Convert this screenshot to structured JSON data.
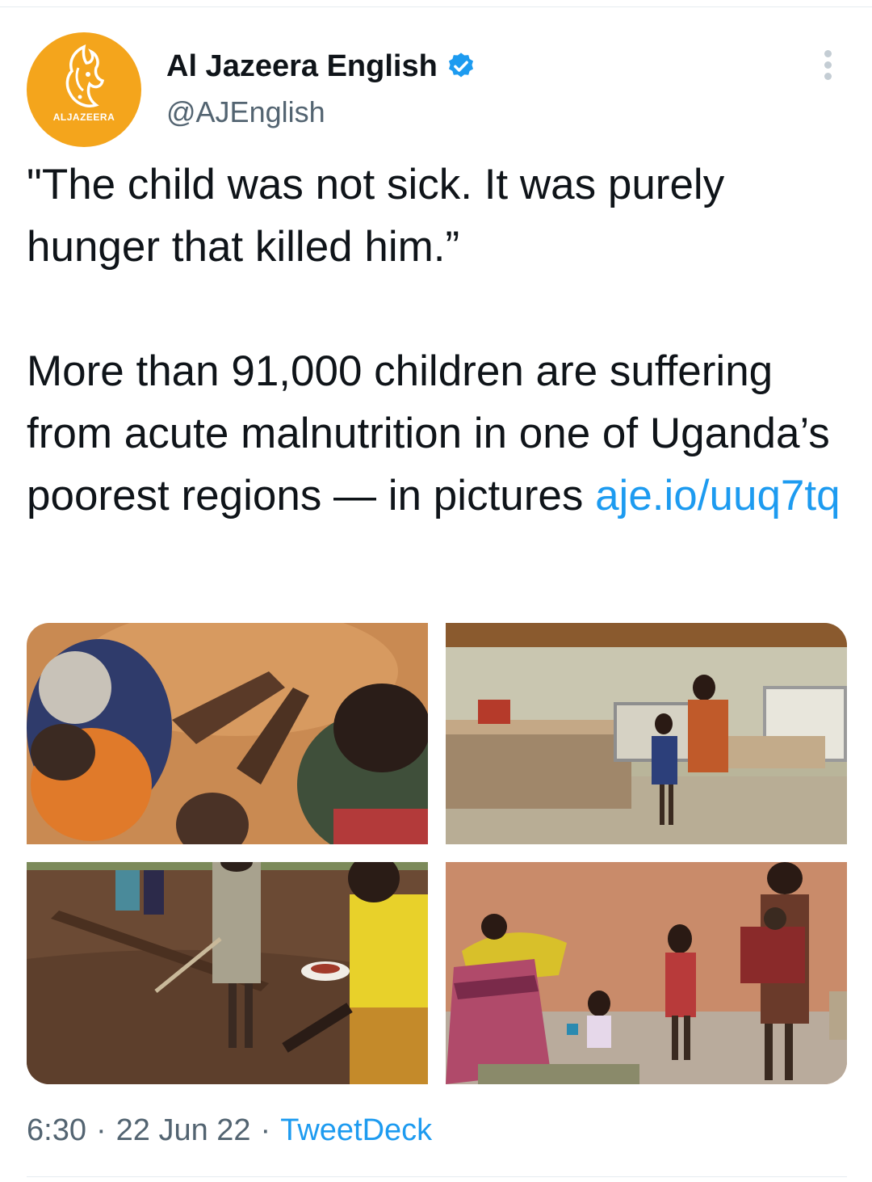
{
  "author": {
    "display_name": "Al Jazeera English",
    "handle": "@AJEnglish",
    "avatar_logo_text": "ALJAZEERA",
    "verified": true,
    "avatar_color": "#f4a51c",
    "verified_color": "#1d9bf0"
  },
  "tweet": {
    "line1": "\"The child was not sick. It was purely hunger that killed him.”",
    "line2_text": "More than 91,000 children are suffering from acute malnutrition in one of Uganda’s poorest regions — in pictures ",
    "link_text": "aje.io/uuq7tq"
  },
  "media": [
    {
      "alt_icon": "photo-children-seated-ground"
    },
    {
      "alt_icon": "photo-hospital-ward-beds"
    },
    {
      "alt_icon": "photo-field-planting"
    },
    {
      "alt_icon": "photo-women-children-courtyard"
    }
  ],
  "meta": {
    "time": "6:30",
    "date": "22 Jun 22",
    "separator": "·",
    "source": "TweetDeck"
  },
  "colors": {
    "text": "#0f1419",
    "muted": "#536471",
    "link": "#1d9bf0"
  }
}
